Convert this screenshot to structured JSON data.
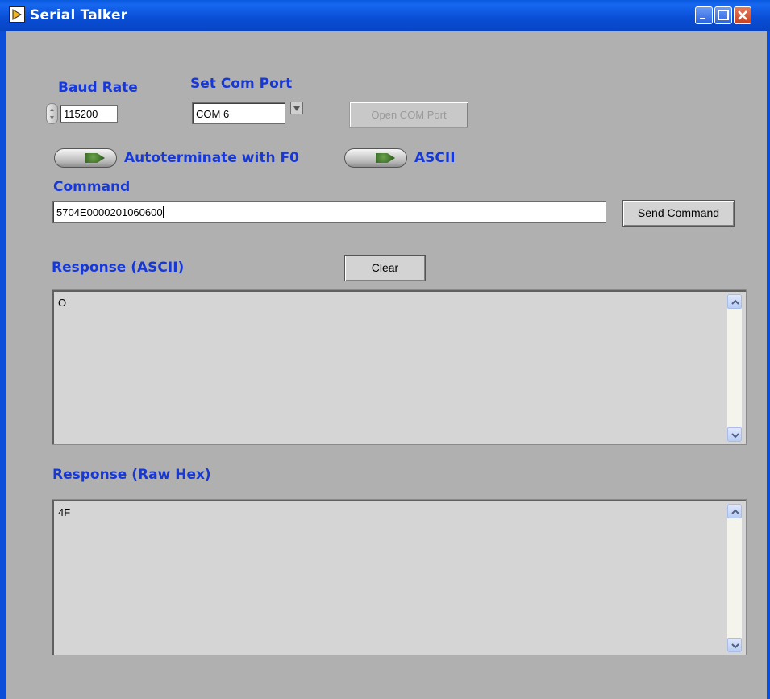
{
  "window": {
    "title": "Serial Talker"
  },
  "baud": {
    "label": "Baud Rate",
    "value": "115200"
  },
  "com": {
    "label": "Set Com Port",
    "value": "COM 6",
    "open_label": "Open COM Port"
  },
  "autoterminate": {
    "label": "Autoterminate with F0"
  },
  "ascii_toggle": {
    "label": "ASCII"
  },
  "command": {
    "label": "Command",
    "value": "5704E0000201060600",
    "send_label": "Send Command"
  },
  "response_ascii": {
    "label": "Response (ASCII)",
    "clear_label": "Clear",
    "text": "O"
  },
  "response_hex": {
    "label": "Response (Raw Hex)",
    "text": "4F"
  }
}
